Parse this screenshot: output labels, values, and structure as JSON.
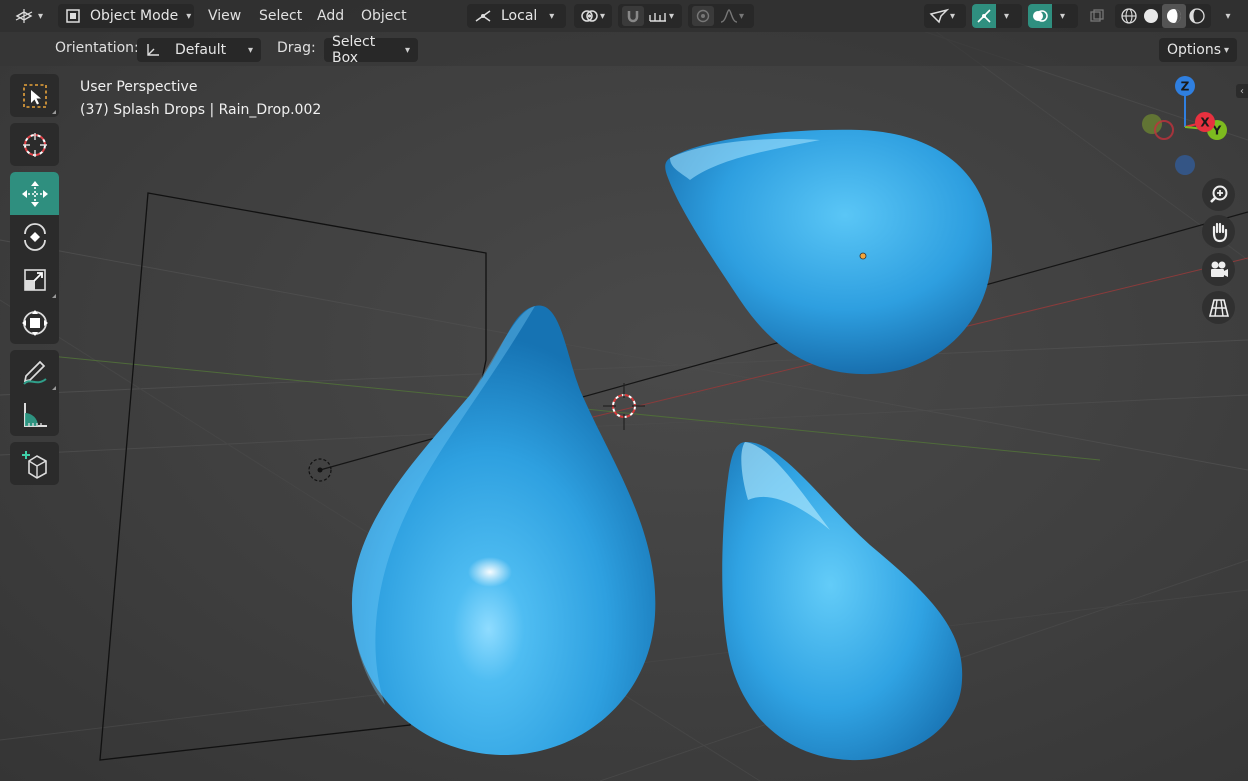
{
  "header": {
    "editor_type": "3d-viewport-icon",
    "mode": {
      "icon": "object-mode-icon",
      "label": "Object Mode"
    },
    "menus": [
      "View",
      "Select",
      "Add",
      "Object"
    ],
    "transform_orientation": {
      "icon": "local-orientation-icon",
      "label": "Local"
    },
    "pivot_icon": "pivot-point-icon",
    "snap_icon": "snap-magnet-icon",
    "snap_target_icon": "snap-increment-icon",
    "proportional_icon": "proportional-edit-icon",
    "falloff_icon": "falloff-curve-icon",
    "visibility_icon": "object-visibility-icon",
    "gizmo_icon": "gizmo-toggle-icon",
    "overlay_icon": "overlay-toggle-icon",
    "xray_icon": "xray-toggle-icon",
    "shading_icons": [
      "wireframe-shading-icon",
      "solid-shading-icon",
      "material-shading-icon",
      "rendered-shading-icon"
    ],
    "active_shading": "material-shading-icon"
  },
  "tool_settings": {
    "orientation_label": "Orientation:",
    "orientation_value": "Default",
    "drag_label": "Drag:",
    "drag_value": "Select Box",
    "options_label": "Options"
  },
  "toolbar": {
    "tools": [
      {
        "name": "select-box-tool",
        "icon": "select-box-icon",
        "active": false
      },
      {
        "name": "cursor-tool",
        "icon": "cursor-icon",
        "active": false
      },
      {
        "name": "move-tool",
        "icon": "move-icon",
        "active": true
      },
      {
        "name": "rotate-tool",
        "icon": "rotate-icon",
        "active": false
      },
      {
        "name": "scale-tool",
        "icon": "scale-icon",
        "active": false
      },
      {
        "name": "transform-tool",
        "icon": "transform-icon",
        "active": false
      },
      {
        "name": "annotate-tool",
        "icon": "annotate-icon",
        "active": false
      },
      {
        "name": "measure-tool",
        "icon": "measure-icon",
        "active": false
      },
      {
        "name": "add-cube-tool",
        "icon": "add-cube-icon",
        "active": false
      }
    ]
  },
  "viewport": {
    "perspective_label": "User Perspective",
    "object_info": "(37) Splash Drops | Rain_Drop.002",
    "drop_color": "#33a6e6",
    "background_color": "#404040"
  },
  "nav_gizmo": {
    "axes": [
      {
        "label": "Z",
        "color": "#2f7fe0"
      },
      {
        "label": "X",
        "color": "#e8313f"
      },
      {
        "label": "Y",
        "color": "#7dbb1f"
      }
    ]
  },
  "nav_buttons": [
    "zoom-icon",
    "pan-hand-icon",
    "camera-view-icon",
    "ortho-grid-icon"
  ]
}
